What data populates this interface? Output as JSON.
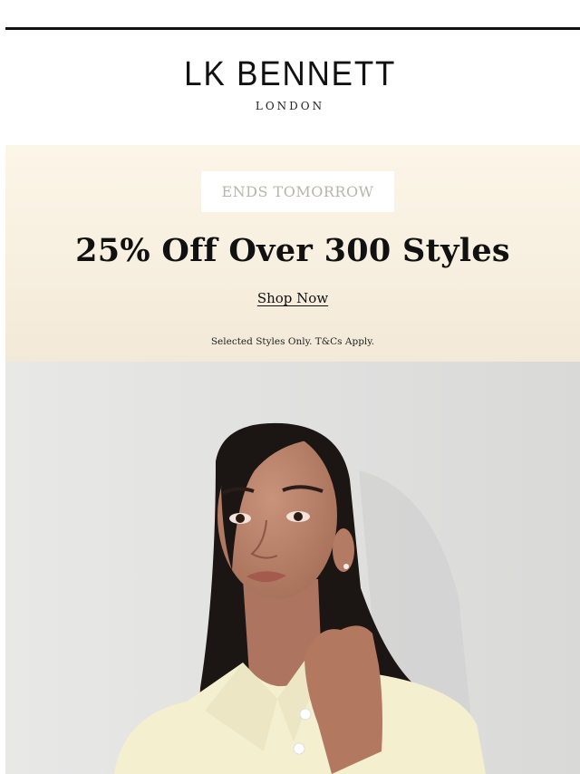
{
  "header": {
    "brand": "LK BENNETT",
    "brand_sub": "LONDON"
  },
  "promo": {
    "badge": "ENDS TOMORROW",
    "headline": "25% Off Over 300 Styles",
    "cta": "Shop Now",
    "terms": "Selected Styles Only. T&Cs Apply."
  },
  "colors": {
    "promo_bg_top": "#fcf6e8",
    "promo_bg_bottom": "#f3e9d8",
    "badge_text": "#b9b4ad",
    "text": "#111111"
  }
}
